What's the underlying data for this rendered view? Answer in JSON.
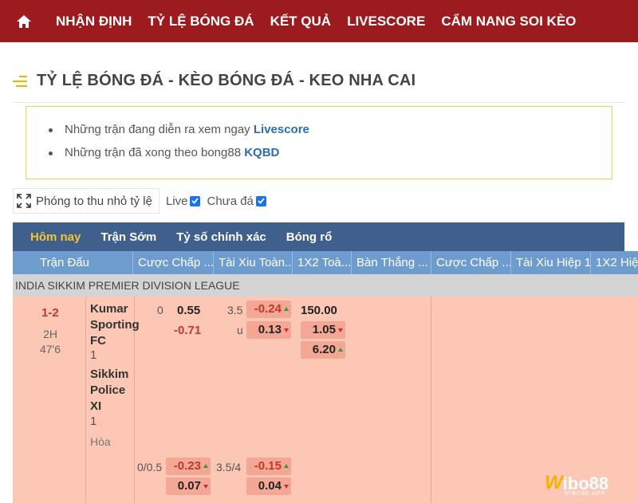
{
  "nav": {
    "items": [
      "NHẬN ĐỊNH",
      "TỶ LỆ BÓNG ĐÁ",
      "KẾT QUẢ",
      "LIVESCORE",
      "CẨM NANG SOI KÈO"
    ]
  },
  "page": {
    "title": "TỶ LỆ BÓNG ĐÁ - KÈO BÓNG ĐÁ - KEO NHA CAI"
  },
  "notice": {
    "line1_text": "Những trận đang diễn ra xem ngay ",
    "line1_link": "Livescore",
    "line2_text": "Những trận đã xong theo bong88 ",
    "line2_link": "KQBD"
  },
  "toolbar": {
    "zoom_label": "Phóng to thu nhỏ tỷ lệ",
    "live_label": "Live",
    "pending_label": "Chưa đá"
  },
  "tabs": [
    {
      "label": "Hôm nay",
      "active": true
    },
    {
      "label": "Trận Sớm",
      "active": false
    },
    {
      "label": "Tỷ số chính xác",
      "active": false
    },
    {
      "label": "Bóng rổ",
      "active": false
    }
  ],
  "columns": [
    "Trận Đấu",
    "Cược Chấp ...",
    "Tài Xiu Toàn...",
    "1X2 Toà...",
    "Bàn Thắng ...",
    "Cược Chấp ...",
    "Tài Xiu Hiệp 1",
    "1X2 Hiệ"
  ],
  "league": "INDIA SIKKIM PREMIER DIVISION LEAGUE",
  "match": {
    "score": "1-2",
    "half": "2H",
    "minute": "47'6",
    "home_team": "Kumar Sporting FC",
    "home_num": "1",
    "away_team": "Sikkim Police XI",
    "away_num": "1",
    "draw": "Hòa",
    "hdp1": "0",
    "hdp1_home": "0.55",
    "hdp1_away": "-0.71",
    "ou1_line": "3.5",
    "ou1_over": "-0.24",
    "ou1_u": "u",
    "ou1_under": "0.13",
    "x12_home": "150.00",
    "x12_away": "1.05",
    "x12_draw": "6.20",
    "hdp2": "0/0.5",
    "hdp2_home": "-0.23",
    "hdp2_away": "0.07",
    "ou2_line": "3.5/4",
    "ou2_over": "-0.15",
    "ou2_under": "0.04"
  },
  "brand": {
    "logo_mark": "W",
    "logo_text": "ibo88",
    "logo_sub": "WIBO88.APP"
  },
  "colors": {
    "nav_bg": "#9b1b1e",
    "tabs_bg": "#3f5f8c",
    "active_tab": "#f6c42b",
    "colhead_bg": "#6f9ccf",
    "match_bg": "#fcc8b5",
    "odd_red": "#c0392b"
  }
}
